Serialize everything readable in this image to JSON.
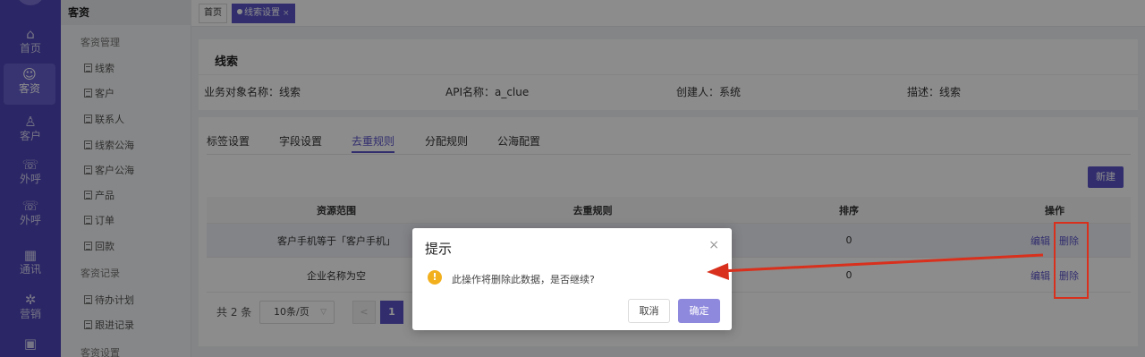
{
  "rail": {
    "items": [
      {
        "label": "首页",
        "icon": "home-icon",
        "glyph": "⌂"
      },
      {
        "label": "客资",
        "icon": "users-icon",
        "glyph": "☺"
      },
      {
        "label": "客户",
        "icon": "person-icon",
        "glyph": "♙"
      },
      {
        "label": "外呼",
        "icon": "phone-outgoing-icon",
        "glyph": "☏"
      },
      {
        "label": "外呼",
        "icon": "phone-forward-icon",
        "glyph": "☏"
      },
      {
        "label": "通讯",
        "icon": "calendar-icon",
        "glyph": "▦"
      },
      {
        "label": "营销",
        "icon": "gear-icon",
        "glyph": "✲"
      },
      {
        "label": "",
        "icon": "box-icon",
        "glyph": "▣"
      }
    ]
  },
  "sidebar": {
    "header": "客资",
    "group1": "客资管理",
    "items1": [
      "线索",
      "客户",
      "联系人",
      "线索公海",
      "客户公海",
      "产品",
      "订单",
      "回款"
    ],
    "group2": "客资记录",
    "items2": [
      "待办计划",
      "跟进记录"
    ],
    "group3": "客资设置"
  },
  "tabs": {
    "home": "首页",
    "active": "线索设置",
    "close": "×"
  },
  "info": {
    "title": "线索",
    "object_name": "业务对象名称：线索",
    "api_name": "API名称：a_clue",
    "creator": "创建人：系统",
    "desc": "描述：线索"
  },
  "subtabs": [
    "标签设置",
    "字段设置",
    "去重规则",
    "分配规则",
    "公海配置"
  ],
  "new_button": "新建",
  "table": {
    "headers": [
      "资源范围",
      "去重规则",
      "排序",
      "操作"
    ],
    "rows": [
      {
        "scope": "客户手机等于「客户手机」",
        "rule": "",
        "order": "0",
        "edit": "编辑",
        "delete": "删除"
      },
      {
        "scope": "企业名称为空",
        "rule": "",
        "order": "0",
        "edit": "编辑",
        "delete": "删除"
      }
    ]
  },
  "pager": {
    "total": "共 2 条",
    "page_size": "10条/页",
    "prev": "<",
    "current": "1"
  },
  "dialog": {
    "title": "提示",
    "close": "×",
    "message": "此操作将删除此数据，是否继续?",
    "warn_glyph": "!",
    "cancel": "取消",
    "confirm": "确定"
  },
  "colors": {
    "brand": "#5b54c9",
    "rail": "#4f46b8",
    "annotation": "#d8301c",
    "warning": "#f2b01e"
  }
}
